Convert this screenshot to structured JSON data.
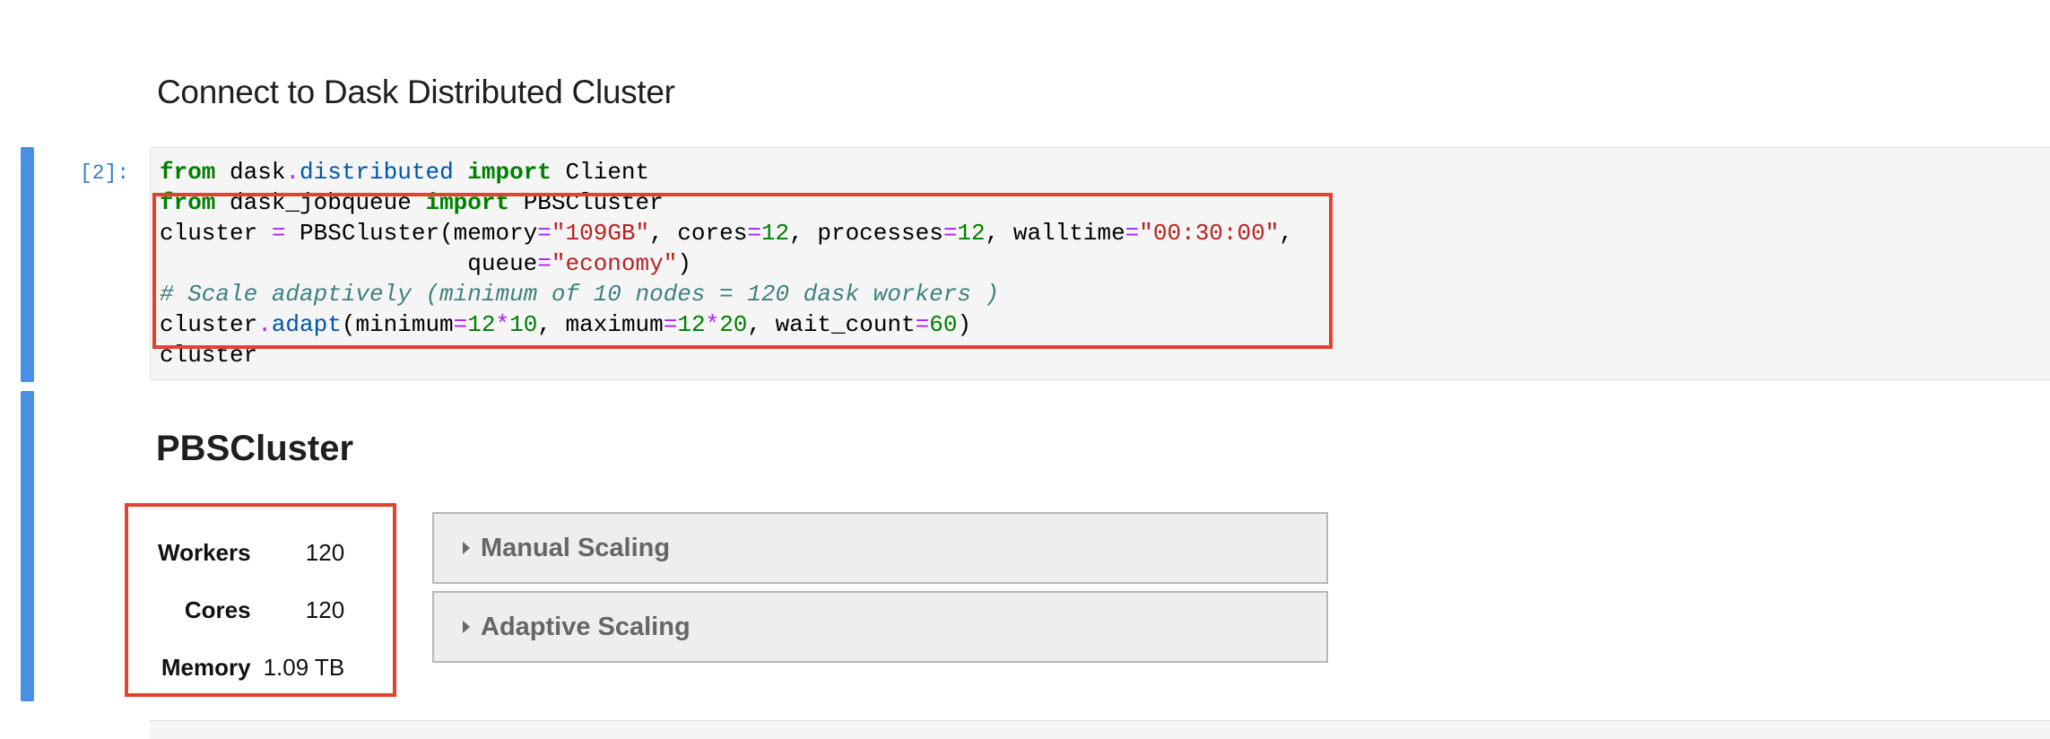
{
  "section_heading": "Connect to Dask Distributed Cluster",
  "cell": {
    "prompt": "[2]:",
    "lines": [
      [
        {
          "t": "from",
          "c": "kw"
        },
        {
          "t": " dask"
        },
        {
          "t": ".",
          "c": "op"
        },
        {
          "t": "distributed",
          "c": "mod"
        },
        {
          "t": " "
        },
        {
          "t": "import",
          "c": "kw"
        },
        {
          "t": " Client"
        }
      ],
      [
        {
          "t": "from",
          "c": "kw"
        },
        {
          "t": " dask_jobqueue "
        },
        {
          "t": "import",
          "c": "kw"
        },
        {
          "t": " PBSCluster"
        }
      ],
      [
        {
          "t": "cluster "
        },
        {
          "t": "=",
          "c": "op"
        },
        {
          "t": " PBSCluster(memory"
        },
        {
          "t": "=",
          "c": "op"
        },
        {
          "t": "\"109GB\"",
          "c": "str"
        },
        {
          "t": ", cores"
        },
        {
          "t": "=",
          "c": "op"
        },
        {
          "t": "12",
          "c": "num"
        },
        {
          "t": ", processes"
        },
        {
          "t": "=",
          "c": "op"
        },
        {
          "t": "12",
          "c": "num"
        },
        {
          "t": ", walltime"
        },
        {
          "t": "=",
          "c": "op"
        },
        {
          "t": "\"00:30:00\"",
          "c": "str"
        },
        {
          "t": ","
        }
      ],
      [
        {
          "t": "                      queue"
        },
        {
          "t": "=",
          "c": "op"
        },
        {
          "t": "\"economy\"",
          "c": "str"
        },
        {
          "t": ")"
        }
      ],
      [
        {
          "t": "# Scale adaptively (minimum of 10 nodes = 120 dask workers )",
          "c": "cm"
        }
      ],
      [
        {
          "t": "cluster"
        },
        {
          "t": ".",
          "c": "op"
        },
        {
          "t": "adapt",
          "c": "mod"
        },
        {
          "t": "(minimum"
        },
        {
          "t": "=",
          "c": "op"
        },
        {
          "t": "12",
          "c": "num"
        },
        {
          "t": "*",
          "c": "op"
        },
        {
          "t": "10",
          "c": "num"
        },
        {
          "t": ", maximum"
        },
        {
          "t": "=",
          "c": "op"
        },
        {
          "t": "12",
          "c": "num"
        },
        {
          "t": "*",
          "c": "op"
        },
        {
          "t": "20",
          "c": "num"
        },
        {
          "t": ", wait_count"
        },
        {
          "t": "=",
          "c": "op"
        },
        {
          "t": "60",
          "c": "num"
        },
        {
          "t": ")"
        }
      ],
      [
        {
          "t": "cluster"
        }
      ]
    ]
  },
  "output": {
    "title": "PBSCluster",
    "stats": [
      {
        "label": "Workers",
        "value": "120"
      },
      {
        "label": "Cores",
        "value": "120"
      },
      {
        "label": "Memory",
        "value": "1.09 TB"
      }
    ],
    "manual_scaling_label": "Manual Scaling",
    "adaptive_scaling_label": "Adaptive Scaling"
  },
  "colors": {
    "collapser": "#4a90e2",
    "highlight_box": "#e0432e",
    "prompt": "#307fc1"
  }
}
